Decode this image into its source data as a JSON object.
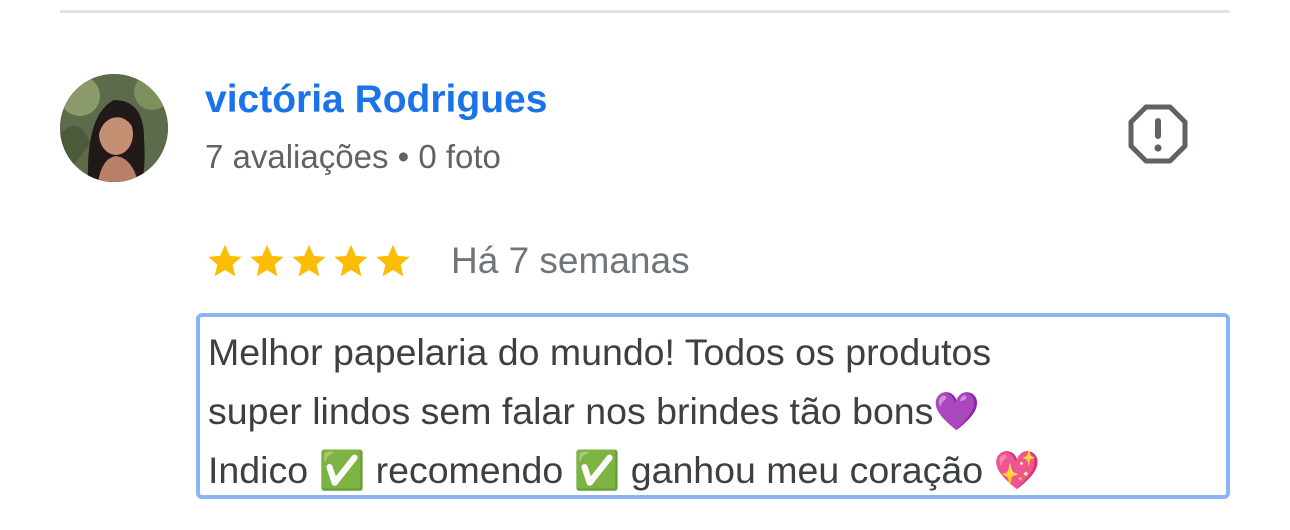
{
  "reviewer": {
    "name": "victória Rodrigues",
    "meta": "7 avaliações • 0 foto"
  },
  "review": {
    "rating": 5,
    "rating_max": 5,
    "date": "Há 7 semanas",
    "text": "Melhor papelaria do mundo! Todos os produtos\nsuper lindos sem falar nos brindes tão bons💜\nIndico ✅ recomendo ✅ ganhou meu coração 💖"
  },
  "icons": {
    "report": "report-flag-octagon-icon",
    "star": "star-icon"
  },
  "colors": {
    "name_link": "#1a73e8",
    "star": "#fbbc04",
    "meta_text": "#5f6368",
    "focus_border": "#8ab4f8"
  }
}
